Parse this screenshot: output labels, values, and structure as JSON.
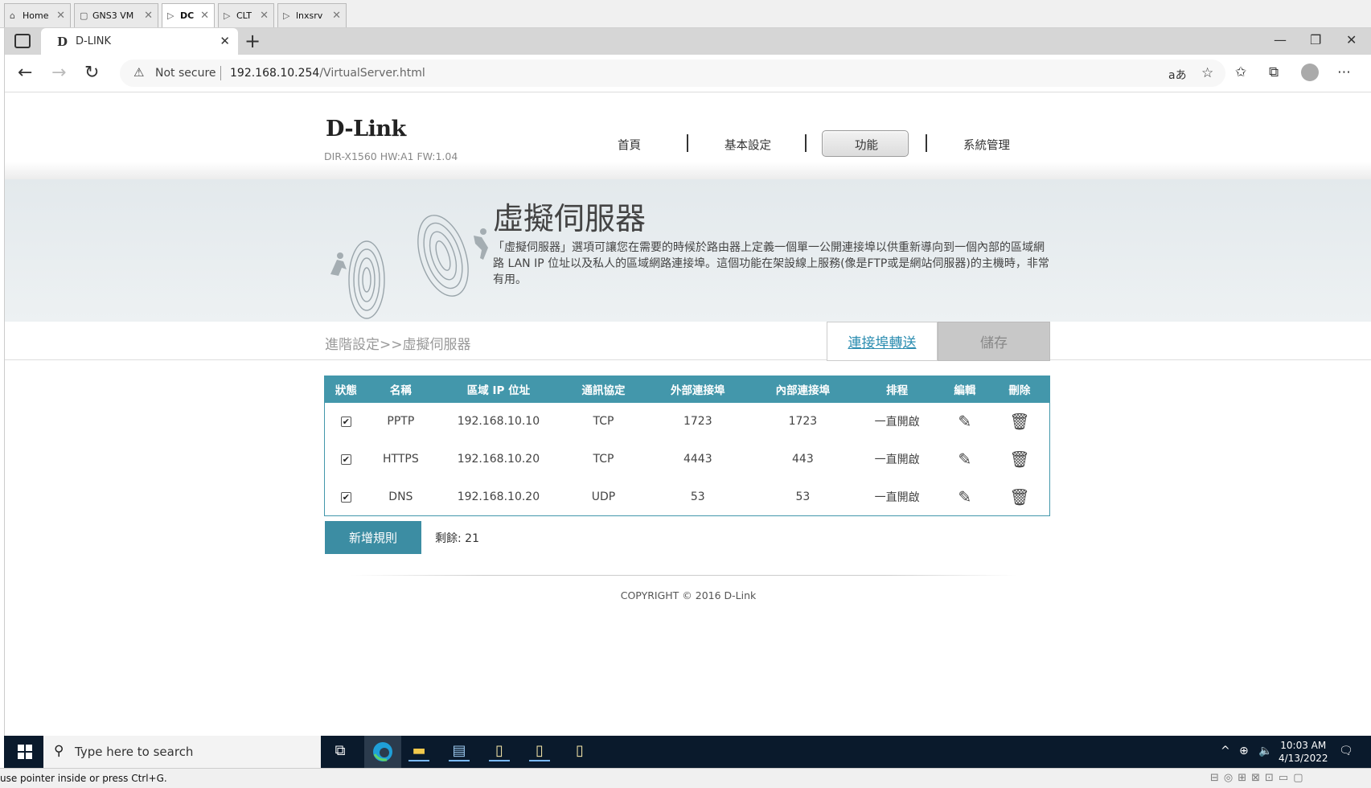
{
  "vm_tabs": [
    {
      "label": "Home",
      "icon": "home-icon"
    },
    {
      "label": "GNS3 VM",
      "icon": "vm-icon"
    },
    {
      "label": "DC",
      "icon": "vm-running-icon"
    },
    {
      "label": "CLT",
      "icon": "vm-running-icon"
    },
    {
      "label": "lnxsrv",
      "icon": "vm-running-icon"
    }
  ],
  "browser": {
    "tab_title": "D-LINK",
    "security_label": "Not secure",
    "url_host": "192.168.10.254",
    "url_path": "/VirtualServer.html"
  },
  "header": {
    "logo": "D-Link",
    "model": "DIR-X1560 HW:A1 FW:1.04",
    "nav": [
      "首頁",
      "基本設定",
      "功能",
      "系統管理"
    ],
    "active_nav": "功能"
  },
  "banner": {
    "title": "虛擬伺服器",
    "description": "「虛擬伺服器」選項可讓您在需要的時候於路由器上定義一個單一公開連接埠以供重新導向到一個內部的區域網路 LAN IP 位址以及私人的區域網路連接埠。這個功能在架設線上服務(像是FTP或是網站伺服器)的主機時，非常有用。"
  },
  "breadcrumb": "進階設定>>虛擬伺服器",
  "buttons": {
    "port_forwarding": "連接埠轉送",
    "save": "儲存",
    "add_rule": "新增規則"
  },
  "table": {
    "headers": [
      "狀態",
      "名稱",
      "區域 IP 位址",
      "通訊協定",
      "外部連接埠",
      "內部連接埠",
      "排程",
      "編輯",
      "刪除"
    ],
    "rows": [
      {
        "enabled": true,
        "name": "PPTP",
        "ip": "192.168.10.10",
        "protocol": "TCP",
        "external": "1723",
        "internal": "1723",
        "schedule": "一直開啟"
      },
      {
        "enabled": true,
        "name": "HTTPS",
        "ip": "192.168.10.20",
        "protocol": "TCP",
        "external": "4443",
        "internal": "443",
        "schedule": "一直開啟"
      },
      {
        "enabled": true,
        "name": "DNS",
        "ip": "192.168.10.20",
        "protocol": "UDP",
        "external": "53",
        "internal": "53",
        "schedule": "一直開啟"
      }
    ]
  },
  "remaining": "剩餘: 21",
  "copyright": "COPYRIGHT © 2016 D-Link",
  "taskbar": {
    "search_placeholder": "Type here to search",
    "time": "10:03 AM",
    "date": "4/13/2022"
  },
  "status_message": "use pointer inside or press Ctrl+G.",
  "colors": {
    "accent": "#4397ab",
    "button": "#3c8da3",
    "link": "#2a8cb0"
  }
}
